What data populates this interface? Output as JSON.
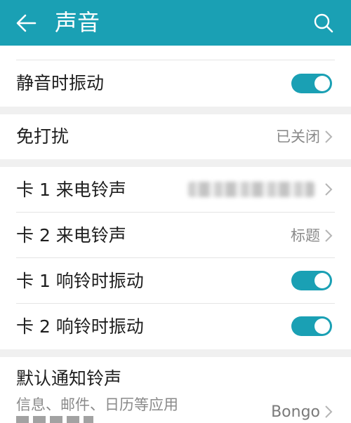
{
  "header": {
    "title": "声音",
    "back_icon": "arrow-left-icon",
    "search_icon": "search-icon",
    "color": "#1aa0b4"
  },
  "settings": {
    "silent_vibrate": {
      "label": "静音时振动",
      "enabled": true
    },
    "dnd": {
      "label": "免打扰",
      "value": "已关闭"
    },
    "sim1_ringtone": {
      "label": "卡 1 来电铃声"
    },
    "sim2_ringtone": {
      "label": "卡 2 来电铃声",
      "value": "标题"
    },
    "sim1_vibrate": {
      "label": "卡 1 响铃时振动",
      "enabled": true
    },
    "sim2_vibrate": {
      "label": "卡 2 响铃时振动",
      "enabled": true
    },
    "notification_tone": {
      "label": "默认通知铃声",
      "subtitle": "信息、邮件、日历等应用",
      "value": "Bongo"
    }
  },
  "colors": {
    "accent": "#1aa0b4",
    "section_gap": "#f0f0f0",
    "secondary_text": "#8a8a8a"
  }
}
